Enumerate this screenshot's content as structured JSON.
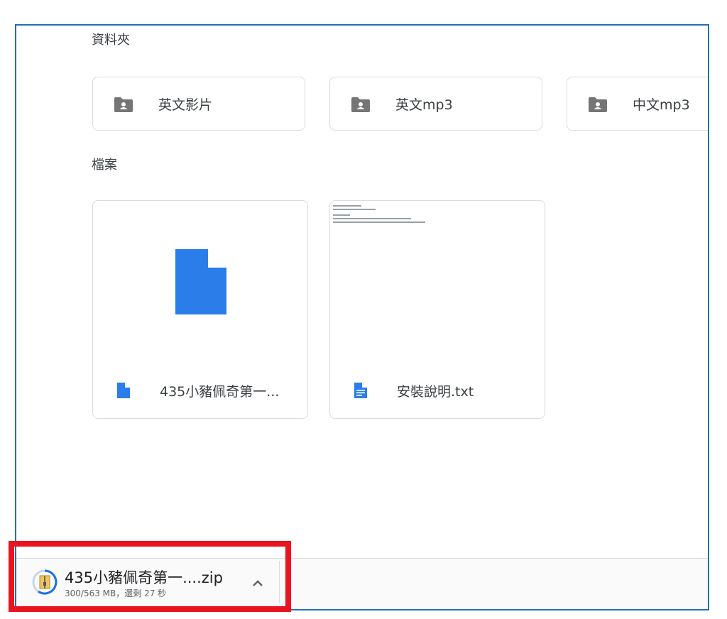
{
  "sections": {
    "folders_label": "資料夾",
    "files_label": "檔案"
  },
  "folders": [
    {
      "name": "英文影片"
    },
    {
      "name": "英文mp3"
    },
    {
      "name": "中文mp3"
    }
  ],
  "files": [
    {
      "name": "435小豬佩奇第一..."
    },
    {
      "name": "安裝說明.txt"
    }
  ],
  "download": {
    "file_name": "435小豬佩奇第一....zip",
    "status": "300/563 MB，還剩 27 秒"
  },
  "colors": {
    "frame_border": "#1f6fb8",
    "file_icon_blue": "#2b7de9",
    "highlight_red": "#e8141f",
    "folder_gray": "#757575"
  }
}
